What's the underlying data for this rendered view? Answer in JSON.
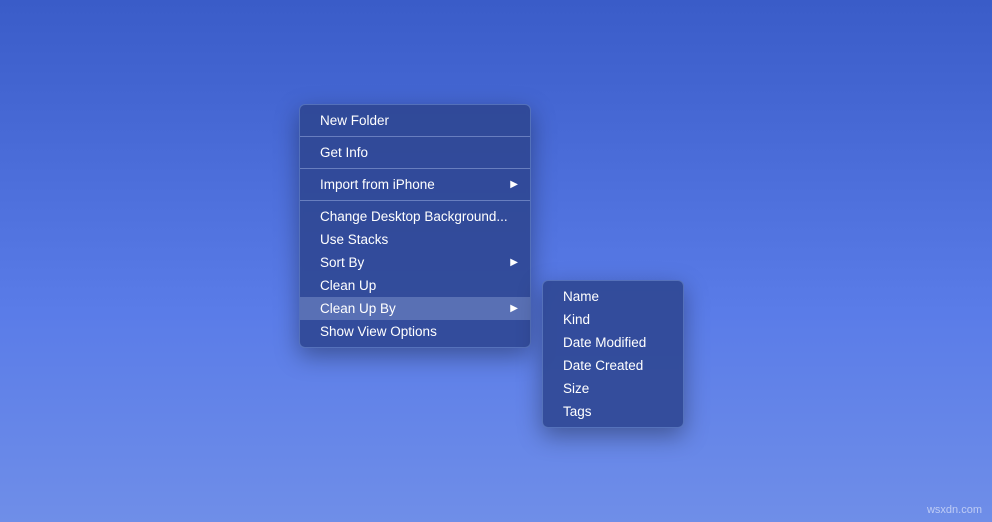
{
  "menu": {
    "groups": [
      [
        {
          "label": "New Folder",
          "hasSubmenu": false
        }
      ],
      [
        {
          "label": "Get Info",
          "hasSubmenu": false
        }
      ],
      [
        {
          "label": "Import from iPhone",
          "hasSubmenu": true
        }
      ],
      [
        {
          "label": "Change Desktop Background...",
          "hasSubmenu": false
        },
        {
          "label": "Use Stacks",
          "hasSubmenu": false
        },
        {
          "label": "Sort By",
          "hasSubmenu": true
        },
        {
          "label": "Clean Up",
          "hasSubmenu": false
        },
        {
          "label": "Clean Up By",
          "hasSubmenu": true,
          "highlighted": true
        },
        {
          "label": "Show View Options",
          "hasSubmenu": false
        }
      ]
    ]
  },
  "submenu": {
    "items": [
      {
        "label": "Name"
      },
      {
        "label": "Kind"
      },
      {
        "label": "Date Modified"
      },
      {
        "label": "Date Created"
      },
      {
        "label": "Size"
      },
      {
        "label": "Tags"
      }
    ]
  },
  "watermark": "wsxdn.com"
}
